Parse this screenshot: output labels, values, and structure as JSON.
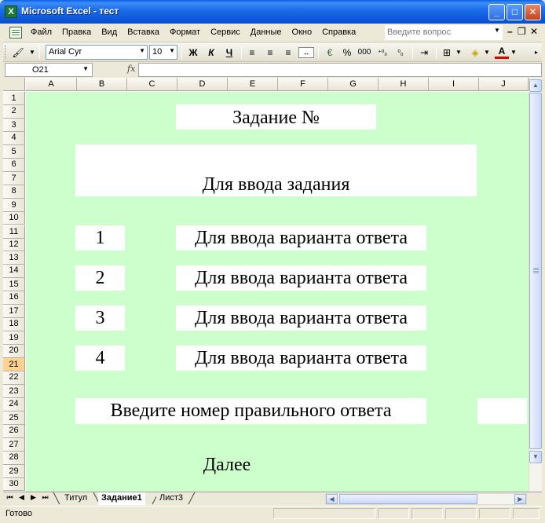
{
  "window": {
    "title": "Microsoft Excel - тест",
    "min": "_",
    "max": "□",
    "close": "✕",
    "app_icon": "X"
  },
  "menubar": {
    "items": [
      "Файл",
      "Правка",
      "Вид",
      "Вставка",
      "Формат",
      "Сервис",
      "Данные",
      "Окно",
      "Справка"
    ],
    "help_placeholder": "Введите вопрос",
    "mdi_min": "–",
    "mdi_restore": "❐",
    "mdi_close": "✕"
  },
  "toolbar": {
    "font_name": "Arial Cyr",
    "font_size": "10",
    "bold": "Ж",
    "italic": "К",
    "underline": "Ч",
    "percent": "%",
    "thousands": "000",
    "inc_decimal": "⁺⁰₀",
    "dec_decimal": "⁰₀",
    "font_color_letter": "A"
  },
  "formulabar": {
    "cell_ref": "O21",
    "fx": "fx",
    "content": ""
  },
  "grid": {
    "columns": [
      "A",
      "B",
      "C",
      "D",
      "E",
      "F",
      "G",
      "H",
      "I",
      "J"
    ],
    "rows": [
      "1",
      "2",
      "3",
      "4",
      "5",
      "6",
      "7",
      "8",
      "9",
      "10",
      "11",
      "12",
      "13",
      "14",
      "15",
      "16",
      "17",
      "18",
      "19",
      "20",
      "21",
      "22",
      "23",
      "24",
      "25",
      "26",
      "27",
      "28",
      "29",
      "30"
    ],
    "selected_row": "21"
  },
  "content": {
    "task_title": "Задание №",
    "task_input": "Для ввода задания",
    "answers": [
      {
        "number": "1",
        "text": "Для ввода варианта ответа"
      },
      {
        "number": "2",
        "text": "Для ввода варианта ответа"
      },
      {
        "number": "3",
        "text": "Для ввода варианта ответа"
      },
      {
        "number": "4",
        "text": "Для ввода варианта ответа"
      }
    ],
    "prompt": "Введите номер правильного ответа",
    "answer_value": "",
    "next": "Далее"
  },
  "sheets": {
    "tabs": [
      "Титул",
      "Задание1",
      "Лист3"
    ],
    "active": "Задание1"
  },
  "status": {
    "text": "Готово"
  }
}
